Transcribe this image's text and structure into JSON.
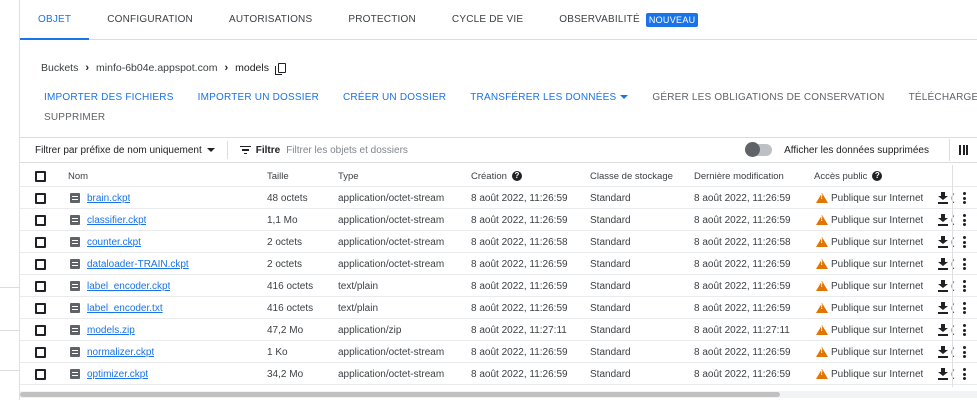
{
  "tabs": [
    {
      "label": "OBJET",
      "active": true
    },
    {
      "label": "CONFIGURATION",
      "active": false
    },
    {
      "label": "AUTORISATIONS",
      "active": false
    },
    {
      "label": "PROTECTION",
      "active": false
    },
    {
      "label": "CYCLE DE VIE",
      "active": false
    },
    {
      "label": "OBSERVABILITÉ",
      "active": false,
      "badge": "NOUVEAU"
    }
  ],
  "breadcrumb": {
    "root": "Buckets",
    "bucket": "minfo-6b04e.appspot.com",
    "current": "models"
  },
  "actions": {
    "upload_files": "IMPORTER DES FICHIERS",
    "upload_folder": "IMPORTER UN DOSSIER",
    "create_folder": "CRÉER UN DOSSIER",
    "transfer_data": "TRANSFÉRER LES DONNÉES",
    "manage_holds": "GÉRER LES OBLIGATIONS DE CONSERVATION",
    "download": "TÉLÉCHARGER",
    "delete": "SUPPRIMER"
  },
  "filter": {
    "prefix_select": "Filtrer par préfixe de nom uniquement",
    "label": "Filtre",
    "placeholder": "Filtrer les objets et dossiers",
    "show_deleted": "Afficher les données supprimées"
  },
  "table": {
    "headers": {
      "name": "Nom",
      "size": "Taille",
      "type": "Type",
      "created": "Création",
      "storage_class": "Classe de stockage",
      "modified": "Dernière modification",
      "public_access": "Accès public"
    },
    "rows": [
      {
        "name": "brain.ckpt",
        "size": "48 octets",
        "type": "application/octet-stream",
        "created": "8 août 2022, 11:26:59",
        "storage_class": "Standard",
        "modified": "8 août 2022, 11:26:59",
        "public_access": "Publique sur Internet",
        "cut": "("
      },
      {
        "name": "classifier.ckpt",
        "size": "1,1 Mo",
        "type": "application/octet-stream",
        "created": "8 août 2022, 11:26:59",
        "storage_class": "Standard",
        "modified": "8 août 2022, 11:26:59",
        "public_access": "Publique sur Internet",
        "cut": "("
      },
      {
        "name": "counter.ckpt",
        "size": "2 octets",
        "type": "application/octet-stream",
        "created": "8 août 2022, 11:26:58",
        "storage_class": "Standard",
        "modified": "8 août 2022, 11:26:58",
        "public_access": "Publique sur Internet",
        "cut": "("
      },
      {
        "name": "dataloader-TRAIN.ckpt",
        "size": "2 octets",
        "type": "application/octet-stream",
        "created": "8 août 2022, 11:26:59",
        "storage_class": "Standard",
        "modified": "8 août 2022, 11:26:59",
        "public_access": "Publique sur Internet",
        "cut": "("
      },
      {
        "name": "label_encoder.ckpt",
        "size": "416 octets",
        "type": "text/plain",
        "created": "8 août 2022, 11:26:59",
        "storage_class": "Standard",
        "modified": "8 août 2022, 11:26:59",
        "public_access": "Publique sur Internet",
        "cut": "("
      },
      {
        "name": "label_encoder.txt",
        "size": "416 octets",
        "type": "text/plain",
        "created": "8 août 2022, 11:26:59",
        "storage_class": "Standard",
        "modified": "8 août 2022, 11:26:59",
        "public_access": "Publique sur Internet",
        "cut": "("
      },
      {
        "name": "models.zip",
        "size": "47,2 Mo",
        "type": "application/zip",
        "created": "8 août 2022, 11:27:11",
        "storage_class": "Standard",
        "modified": "8 août 2022, 11:27:11",
        "public_access": "Publique sur Internet",
        "cut": "("
      },
      {
        "name": "normalizer.ckpt",
        "size": "1 Ko",
        "type": "application/octet-stream",
        "created": "8 août 2022, 11:26:59",
        "storage_class": "Standard",
        "modified": "8 août 2022, 11:26:59",
        "public_access": "Publique sur Internet",
        "cut": "("
      },
      {
        "name": "optimizer.ckpt",
        "size": "34,2 Mo",
        "type": "application/octet-stream",
        "created": "8 août 2022, 11:26:59",
        "storage_class": "Standard",
        "modified": "8 août 2022, 11:26:59",
        "public_access": "Publique sur Internet",
        "cut": "("
      }
    ]
  },
  "icons": {
    "help": "?",
    "warning_color": "#e37400",
    "accent": "#1a73e8"
  }
}
